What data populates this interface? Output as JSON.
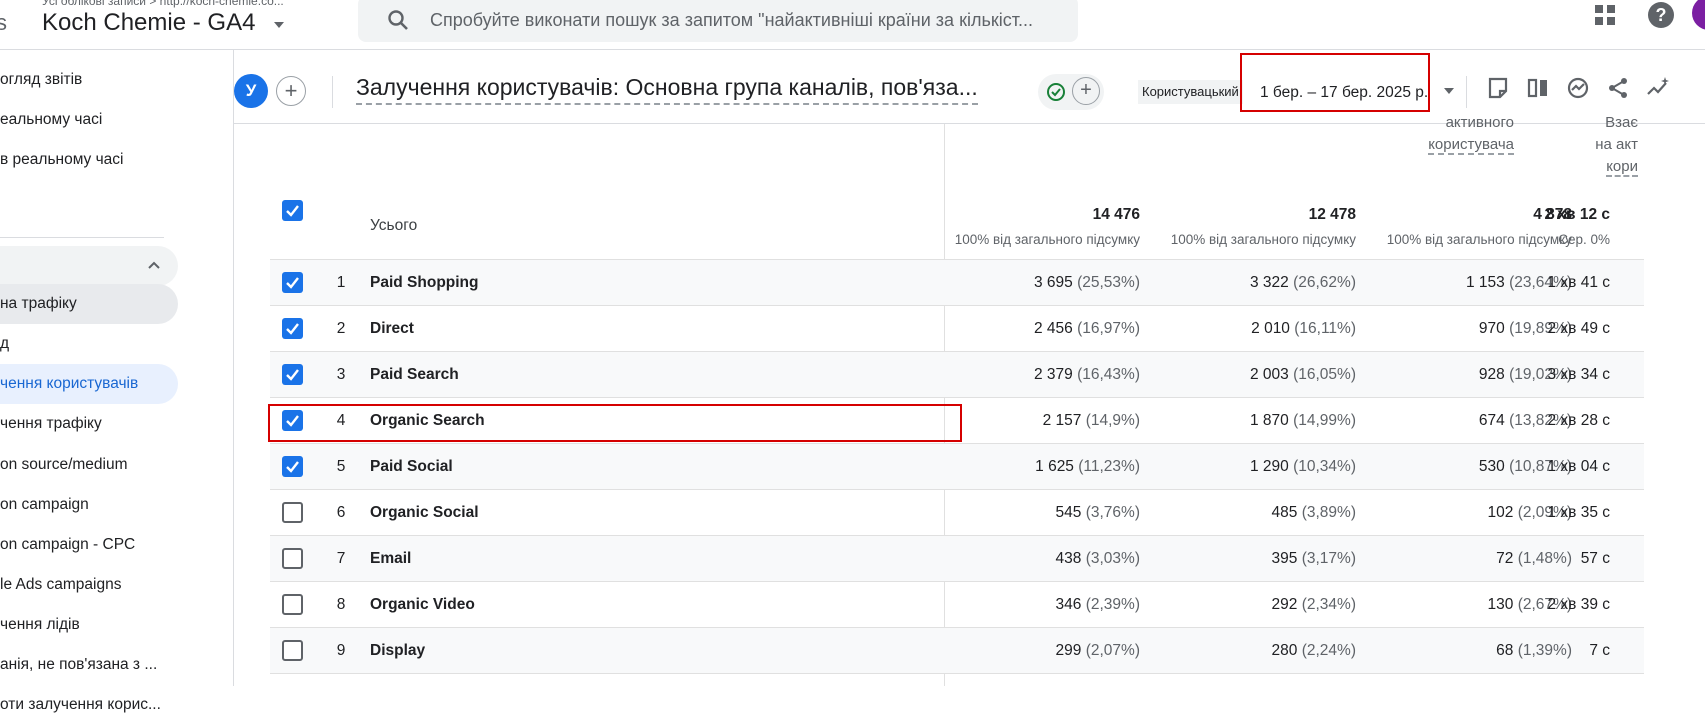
{
  "header": {
    "breadcrumb": "Усі облікові записи > http://koch-chemie.co...",
    "property_name": "Koch Chemie - GA4",
    "search_placeholder": "Спробуйте виконати пошук за запитом \"найактивніші країни за кількіст..."
  },
  "sidebar": {
    "items": [
      {
        "label": "огляд звітів"
      },
      {
        "label": "еальному часі"
      },
      {
        "label": "в реальному часі"
      },
      {
        "label": "на трафіку"
      },
      {
        "label": "д"
      },
      {
        "label": "чення користувачів"
      },
      {
        "label": "чення трафіку"
      },
      {
        "label": "on source/medium"
      },
      {
        "label": "on campaign"
      },
      {
        "label": "on campaign - CPC"
      },
      {
        "label": "le Ads campaigns"
      },
      {
        "label": "чення лідів"
      },
      {
        "label": "анія, не пов'язана з ..."
      },
      {
        "label": "оти залучення корис..."
      }
    ]
  },
  "report": {
    "avatar_letter": "У",
    "title": "Залучення користувачів: Основна група каналів, пов'яза...",
    "custom_label": "Користувацький",
    "date_range": "1 бер. – 17 бер. 2025 р.",
    "colors": {
      "accent": "#1a73e8",
      "highlight": "#d50000"
    }
  },
  "table": {
    "top_headers": [
      {
        "line1": "активного",
        "line2": "користувача"
      },
      {
        "line1": "Взає",
        "line2": "на акт",
        "line3": "кори"
      }
    ],
    "total_label": "Усього",
    "totals": [
      {
        "value": "14 476",
        "sub": "100% від загального підсумку"
      },
      {
        "value": "12 478",
        "sub": "100% від загального підсумку"
      },
      {
        "value": "4 878",
        "sub": "100% від загального підсумку"
      },
      {
        "value": "2 хв 12 с",
        "sub": "Сер. 0%"
      }
    ],
    "rows": [
      {
        "idx": "1",
        "name": "Paid Shopping",
        "checked": true,
        "c1": "3 695",
        "p1": "(25,53%)",
        "c2": "3 322",
        "p2": "(26,62%)",
        "c3": "1 153",
        "p3": "(23,64%)",
        "c4": "1 хв 41 с"
      },
      {
        "idx": "2",
        "name": "Direct",
        "checked": true,
        "c1": "2 456",
        "p1": "(16,97%)",
        "c2": "2 010",
        "p2": "(16,11%)",
        "c3": "970",
        "p3": "(19,89%)",
        "c4": "2 хв 49 с"
      },
      {
        "idx": "3",
        "name": "Paid Search",
        "checked": true,
        "c1": "2 379",
        "p1": "(16,43%)",
        "c2": "2 003",
        "p2": "(16,05%)",
        "c3": "928",
        "p3": "(19,02%)",
        "c4": "3 хв 34 с"
      },
      {
        "idx": "4",
        "name": "Organic Search",
        "checked": true,
        "c1": "2 157",
        "p1": "(14,9%)",
        "c2": "1 870",
        "p2": "(14,99%)",
        "c3": "674",
        "p3": "(13,82%)",
        "c4": "2 хв 28 с"
      },
      {
        "idx": "5",
        "name": "Paid Social",
        "checked": true,
        "c1": "1 625",
        "p1": "(11,23%)",
        "c2": "1 290",
        "p2": "(10,34%)",
        "c3": "530",
        "p3": "(10,87%)",
        "c4": "1 хв 04 с"
      },
      {
        "idx": "6",
        "name": "Organic Social",
        "checked": false,
        "c1": "545",
        "p1": "(3,76%)",
        "c2": "485",
        "p2": "(3,89%)",
        "c3": "102",
        "p3": "(2,09%)",
        "c4": "1 хв 35 с"
      },
      {
        "idx": "7",
        "name": "Email",
        "checked": false,
        "c1": "438",
        "p1": "(3,03%)",
        "c2": "395",
        "p2": "(3,17%)",
        "c3": "72",
        "p3": "(1,48%)",
        "c4": "57 с"
      },
      {
        "idx": "8",
        "name": "Organic Video",
        "checked": false,
        "c1": "346",
        "p1": "(2,39%)",
        "c2": "292",
        "p2": "(2,34%)",
        "c3": "130",
        "p3": "(2,67%)",
        "c4": "2 хв 39 с"
      },
      {
        "idx": "9",
        "name": "Display",
        "checked": false,
        "c1": "299",
        "p1": "(2,07%)",
        "c2": "280",
        "p2": "(2,24%)",
        "c3": "68",
        "p3": "(1,39%)",
        "c4": "7 с"
      }
    ]
  }
}
